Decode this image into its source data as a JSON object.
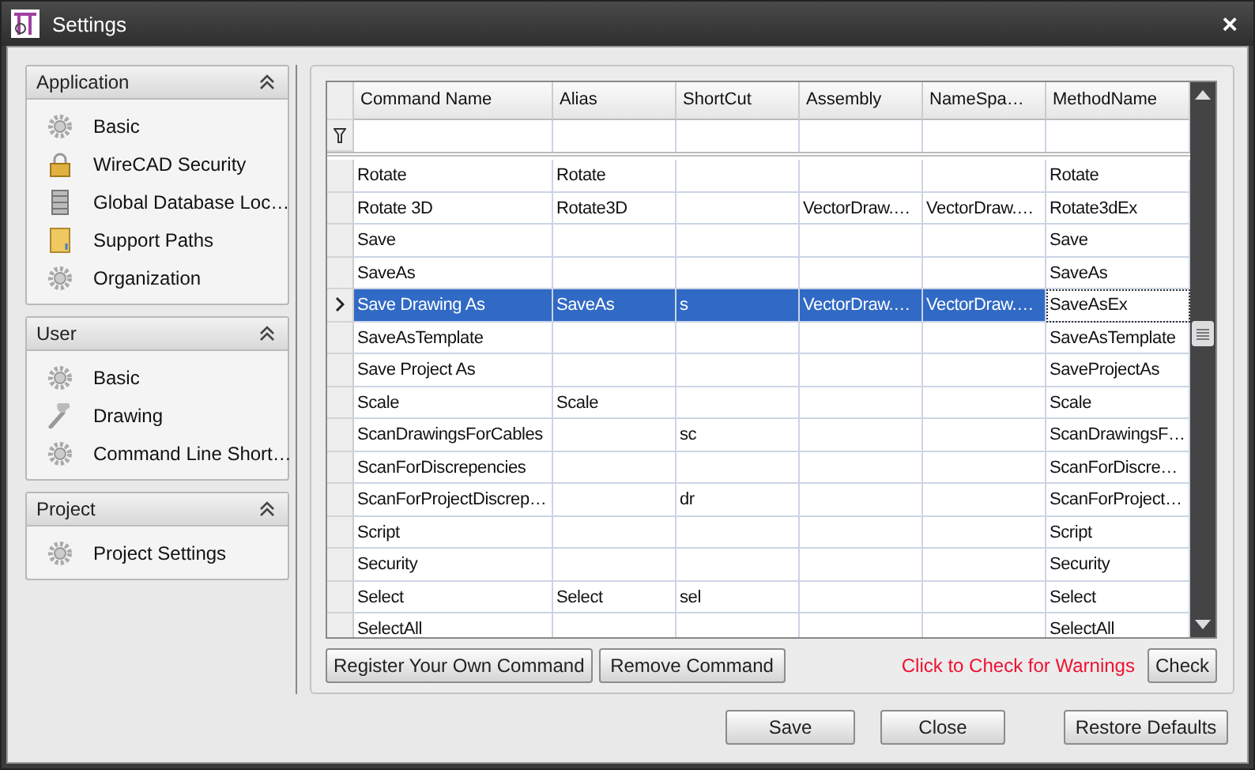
{
  "window": {
    "title": "Settings",
    "close": "×"
  },
  "sidebar": [
    {
      "title": "Application",
      "items": [
        {
          "label": "Basic",
          "kind": "gear"
        },
        {
          "label": "WireCAD Security",
          "kind": "lock"
        },
        {
          "label": "Global Database Loc…",
          "kind": "database"
        },
        {
          "label": "Support Paths",
          "kind": "folder"
        },
        {
          "label": "Organization",
          "kind": "gear"
        }
      ]
    },
    {
      "title": "User",
      "items": [
        {
          "label": "Basic",
          "kind": "gear"
        },
        {
          "label": "Drawing",
          "kind": "wrench"
        },
        {
          "label": "Command Line Short…",
          "kind": "gear"
        }
      ]
    },
    {
      "title": "Project",
      "items": [
        {
          "label": "Project Settings",
          "kind": "gear"
        }
      ]
    }
  ],
  "table": {
    "columns": [
      "Command Name",
      "Alias",
      "ShortCut",
      "Assembly",
      "NameSpa…",
      "MethodName"
    ],
    "rows": [
      {
        "cells": [
          "Rotate",
          "Rotate",
          "",
          "",
          "",
          "Rotate"
        ],
        "selected": false
      },
      {
        "cells": [
          "Rotate 3D",
          "Rotate3D",
          "",
          "VectorDraw.…",
          "VectorDraw.…",
          "Rotate3dEx"
        ],
        "selected": false
      },
      {
        "cells": [
          "Save",
          "",
          "",
          "",
          "",
          "Save"
        ],
        "selected": false
      },
      {
        "cells": [
          "SaveAs",
          "",
          "",
          "",
          "",
          "SaveAs"
        ],
        "selected": false
      },
      {
        "cells": [
          "Save Drawing As",
          "SaveAs",
          "s",
          "VectorDraw.…",
          "VectorDraw.…",
          "SaveAsEx"
        ],
        "selected": true
      },
      {
        "cells": [
          "SaveAsTemplate",
          "",
          "",
          "",
          "",
          "SaveAsTemplate"
        ],
        "selected": false
      },
      {
        "cells": [
          "Save Project As",
          "",
          "",
          "",
          "",
          "SaveProjectAs"
        ],
        "selected": false
      },
      {
        "cells": [
          "Scale",
          "Scale",
          "",
          "",
          "",
          "Scale"
        ],
        "selected": false
      },
      {
        "cells": [
          "ScanDrawingsForCables",
          "",
          "sc",
          "",
          "",
          "ScanDrawingsF…"
        ],
        "selected": false
      },
      {
        "cells": [
          "ScanForDiscrepencies",
          "",
          "",
          "",
          "",
          "ScanForDiscre…"
        ],
        "selected": false
      },
      {
        "cells": [
          "ScanForProjectDiscrep…",
          "",
          "dr",
          "",
          "",
          "ScanForProject…"
        ],
        "selected": false
      },
      {
        "cells": [
          "Script",
          "",
          "",
          "",
          "",
          "Script"
        ],
        "selected": false
      },
      {
        "cells": [
          "Security",
          "",
          "",
          "",
          "",
          "Security"
        ],
        "selected": false
      },
      {
        "cells": [
          "Select",
          "Select",
          "sel",
          "",
          "",
          "Select"
        ],
        "selected": false
      },
      {
        "cells": [
          "SelectAll",
          "",
          "",
          "",
          "",
          "SelectAll"
        ],
        "selected": false
      }
    ]
  },
  "grid_buttons": [
    "Register Your Own Command",
    "Remove Command"
  ],
  "warning": "Click to Check for Warnings",
  "check_button": "Check",
  "footer_buttons": [
    "Save",
    "Close",
    "Restore Defaults"
  ]
}
